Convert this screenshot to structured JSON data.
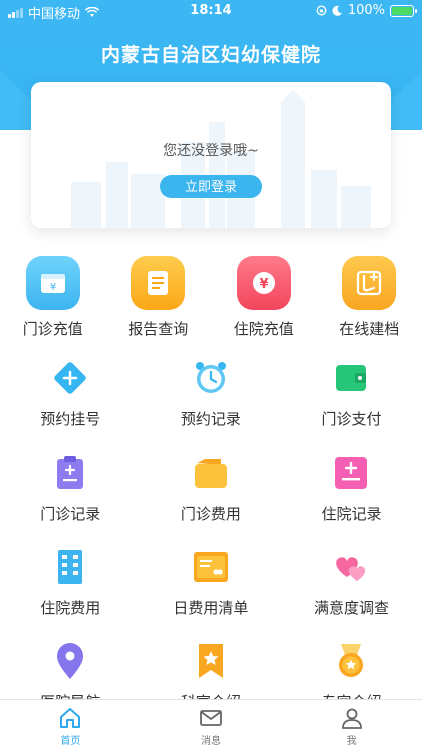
{
  "status_bar": {
    "carrier": "中国移动",
    "time": "18:14",
    "battery": "100%"
  },
  "header": {
    "title": "内蒙古自治区妇幼保健院"
  },
  "login_card": {
    "prompt": "您还没登录哦~",
    "button": "立即登录"
  },
  "primary_services": [
    {
      "label": "门诊充值",
      "icon": "outpatient-recharge-icon"
    },
    {
      "label": "报告查询",
      "icon": "report-query-icon"
    },
    {
      "label": "住院充值",
      "icon": "inpatient-recharge-icon"
    },
    {
      "label": "在线建档",
      "icon": "online-filing-icon"
    }
  ],
  "services": [
    {
      "label": "预约挂号",
      "icon": "appointment-register-icon"
    },
    {
      "label": "预约记录",
      "icon": "alarm-clock-icon"
    },
    {
      "label": "门诊支付",
      "icon": "wallet-icon"
    },
    {
      "label": "门诊记录",
      "icon": "clipboard-icon"
    },
    {
      "label": "门诊费用",
      "icon": "folder-wallet-icon"
    },
    {
      "label": "住院记录",
      "icon": "plus-minus-icon"
    },
    {
      "label": "住院费用",
      "icon": "building-icon"
    },
    {
      "label": "日费用清单",
      "icon": "card-icon"
    },
    {
      "label": "满意度调查",
      "icon": "hearts-icon"
    },
    {
      "label": "医院导航",
      "icon": "location-pin-icon"
    },
    {
      "label": "科室介绍",
      "icon": "bookmark-star-icon"
    },
    {
      "label": "专家介绍",
      "icon": "medal-icon"
    }
  ],
  "tabbar": [
    {
      "label": "首页",
      "active": true
    },
    {
      "label": "消息",
      "active": false
    },
    {
      "label": "我",
      "active": false
    }
  ],
  "colors": {
    "header_blue": "#42bcf6",
    "accent_blue": "#2ea8ef",
    "tile_blue": "#4cc3f5",
    "tile_orange": "#fdb62d",
    "tile_red": "#f5556a",
    "tile_yellow": "#fbb83a"
  }
}
